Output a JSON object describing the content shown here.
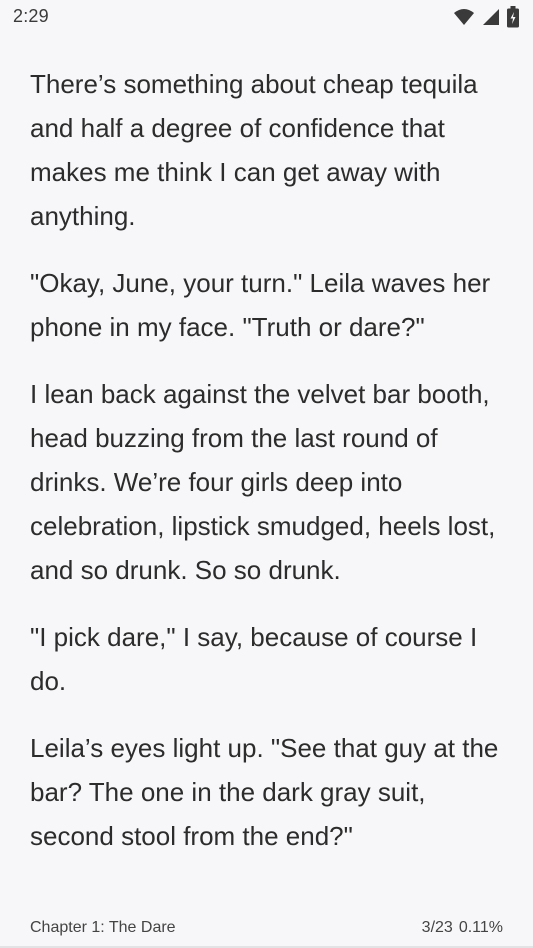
{
  "status_bar": {
    "time": "2:29",
    "icons": [
      "wifi-icon",
      "signal-icon",
      "battery-charging-icon"
    ]
  },
  "reader": {
    "paragraphs": [
      "There’s something about cheap tequila and half a degree of confidence that makes me think I can get away with anything.",
      "\"Okay, June, your turn.\" Leila waves her phone in my face. \"Truth or dare?\"",
      "I lean back against the velvet bar booth, head buzzing from the last round of drinks. We’re four girls deep into celebration, lipstick smudged, heels lost, and so drunk. So so drunk.",
      "\"I pick dare,\" I say, because of course I do.",
      "Leila’s eyes light up. \"See that guy at the bar? The one in the dark gray suit, second stool from the end?\""
    ]
  },
  "footer": {
    "chapter": "Chapter 1: The Dare",
    "page": "3/23",
    "progress": "0.11%"
  },
  "colors": {
    "background": "#f7f7f9",
    "text": "#2c2c2c"
  }
}
